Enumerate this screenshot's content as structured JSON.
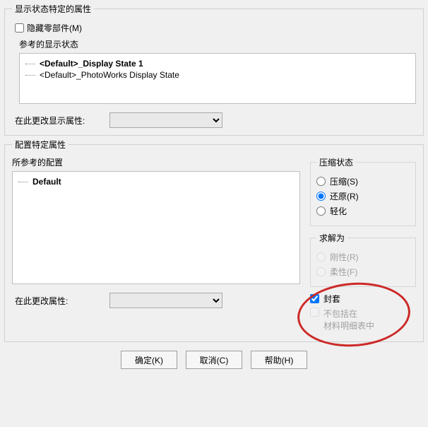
{
  "section1": {
    "legend": "显示状态特定的属性",
    "hide_components_label": "隐藏零部件(M)",
    "reference_display_state_label": "参考的显示状态",
    "display_states": [
      "<Default>_Display State 1",
      "<Default>_PhotoWorks Display State"
    ],
    "change_display_attr_label": "在此更改显示属性:"
  },
  "section2": {
    "legend": "配置特定属性",
    "referenced_config_label": "所参考的配置",
    "configs": [
      "Default"
    ],
    "change_attr_label": "在此更改属性:",
    "compress_group": {
      "legend": "压缩状态",
      "options": {
        "compress": "压缩(S)",
        "restore": "还原(R)",
        "light": "轻化"
      },
      "selected": "restore"
    },
    "solve_group": {
      "legend": "求解为",
      "options": {
        "rigid": "刚性(R)",
        "flexible": "柔性(F)"
      }
    },
    "envelope": {
      "label": "封套",
      "checked": true,
      "exclude_bom_label1": "不包括在",
      "exclude_bom_label2": "材料明细表中"
    }
  },
  "buttons": {
    "ok": "确定(K)",
    "cancel": "取消(C)",
    "help": "帮助(H)"
  }
}
